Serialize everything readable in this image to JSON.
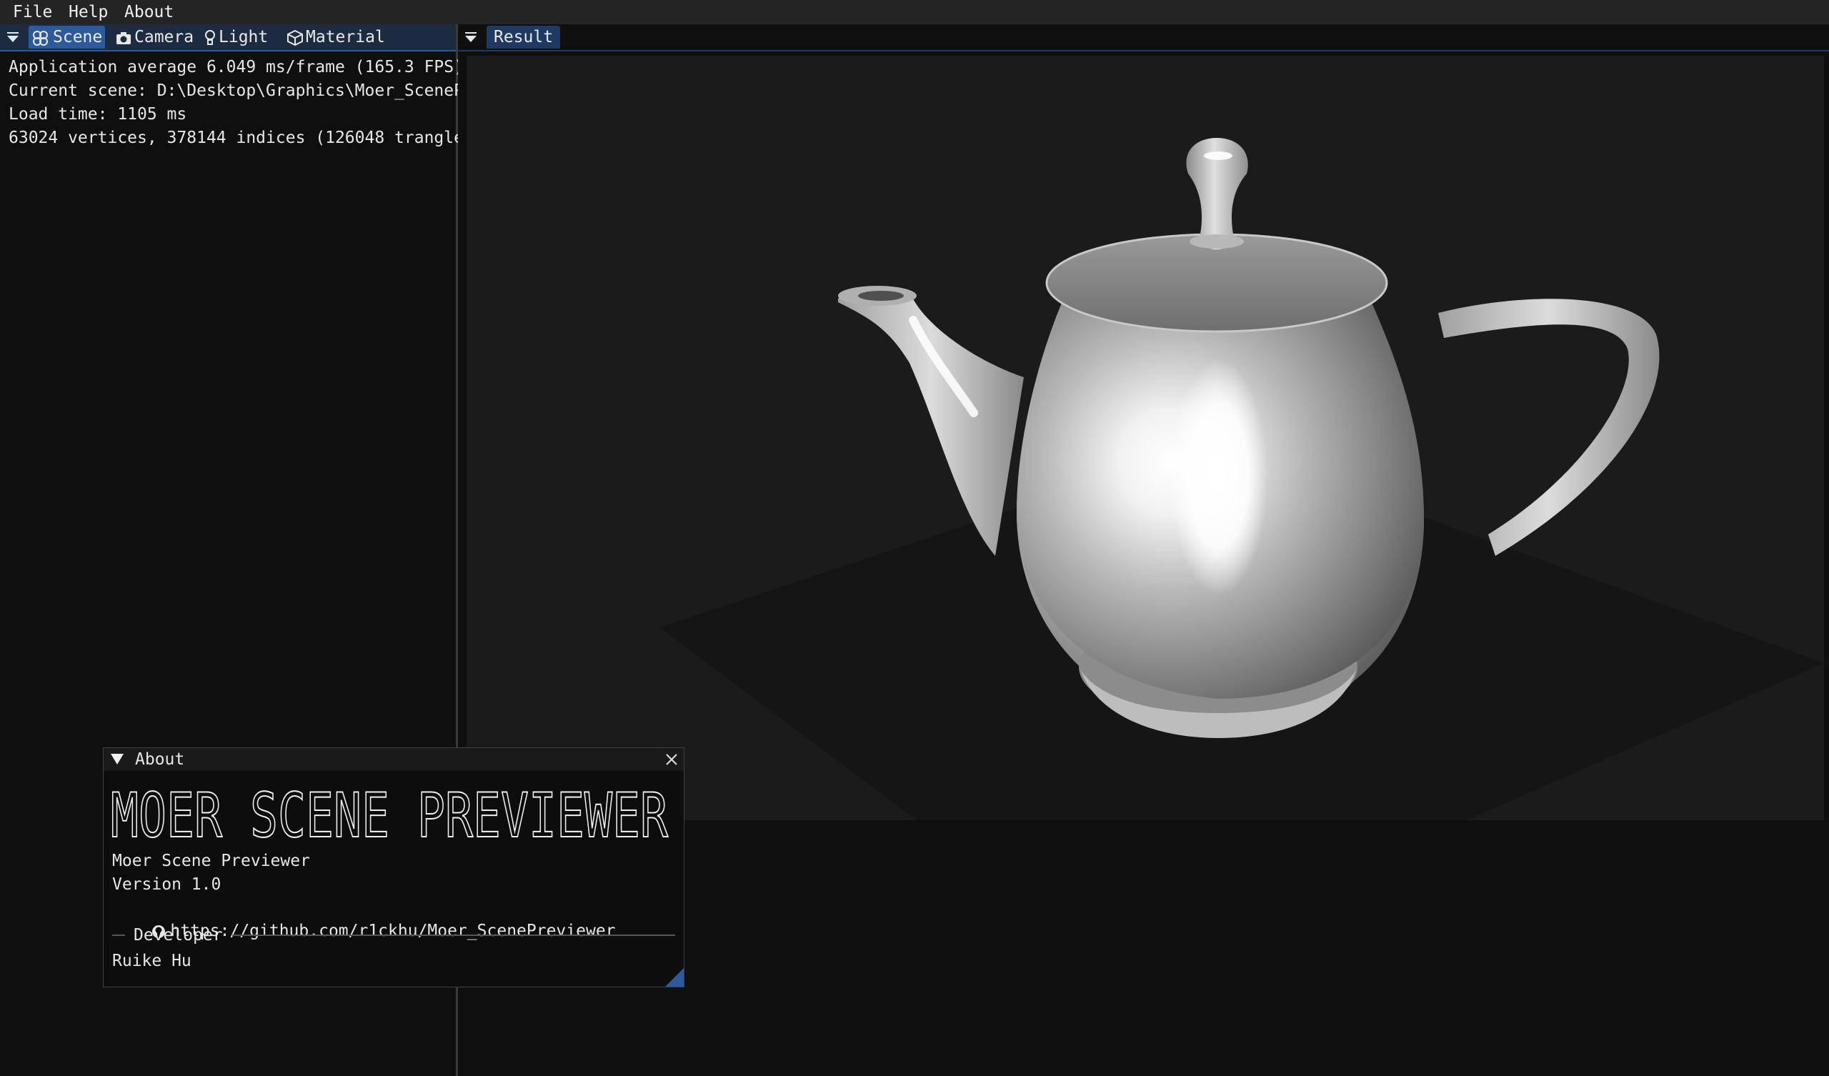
{
  "menu": {
    "file": "File",
    "help": "Help",
    "about": "About"
  },
  "left_panel": {
    "tabs": [
      {
        "label": "Scene",
        "icon": "scene-icon"
      },
      {
        "label": "Camera",
        "icon": "camera-icon"
      },
      {
        "label": "Light",
        "icon": "light-icon"
      },
      {
        "label": "Material",
        "icon": "material-icon"
      }
    ],
    "info": [
      "Application average 6.049 ms/frame (165.3 FPS)",
      "Current scene: D:\\Desktop\\Graphics\\Moer_SceneP",
      "Load time: 1105 ms",
      "63024 vertices, 378144 indices (126048 trangle"
    ]
  },
  "right_panel": {
    "tab": "Result"
  },
  "about_window": {
    "title": "About",
    "logo_text": "MOER SCENE PREVIEWER",
    "app_name": "Moer Scene Previewer",
    "version": "Version 1.0",
    "url": "https://github.com/r1ckhu/Moer_ScenePreviewer",
    "developer_heading": "Developer",
    "developer_name": "Ruike Hu"
  },
  "colors": {
    "accent": "#2c5a9a",
    "background": "#0f0f0f",
    "viewport": "#1b1b1b"
  }
}
